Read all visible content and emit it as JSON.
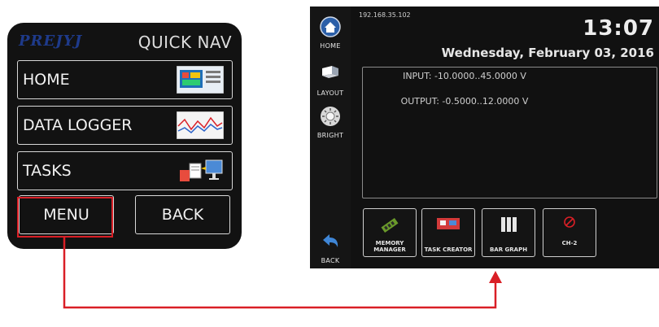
{
  "quick_nav": {
    "brand": "PREJYJ",
    "title": "QUICK NAV",
    "items": [
      {
        "label": "HOME",
        "thumb": "home-screen-thumbnail"
      },
      {
        "label": "DATA LOGGER",
        "thumb": "data-logger-graph-thumbnail"
      },
      {
        "label": "TASKS",
        "thumb": "tasks-icon"
      }
    ],
    "menu_label": "MENU",
    "back_label": "BACK"
  },
  "device": {
    "ip": "192.168.35.102",
    "time": "13:07",
    "date": "Wednesday, February 03, 2016",
    "input_line": "INPUT: -10.0000..45.0000 V",
    "output_line": "OUTPUT: -0.5000..12.0000 V",
    "sidebar": [
      {
        "label": "HOME",
        "icon": "home-icon"
      },
      {
        "label": "LAYOUT",
        "icon": "layout-icon"
      },
      {
        "label": "BRIGHT",
        "icon": "brightness-icon"
      },
      {
        "label": "BACK",
        "icon": "back-arrow-icon"
      }
    ],
    "tiles": [
      {
        "label": "MEMORY\nMANAGER",
        "icon": "memory-chip-icon"
      },
      {
        "label": "TASK CREATOR",
        "icon": "task-creator-icon"
      },
      {
        "label": "BAR GRAPH",
        "icon": "bar-graph-icon"
      },
      {
        "label": "CH-2",
        "icon": "disabled-icon"
      }
    ]
  },
  "colors": {
    "highlight": "#d91f26",
    "brand": "#1e3a8a",
    "panel_bg": "#121212"
  }
}
